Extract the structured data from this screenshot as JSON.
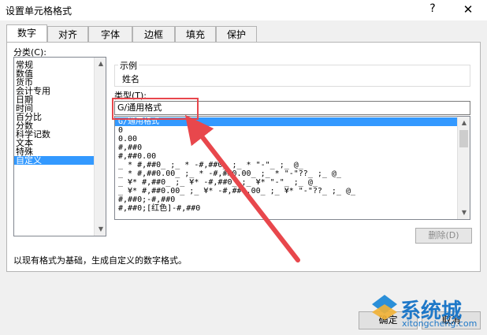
{
  "window": {
    "title": "设置单元格格式",
    "help": "?",
    "close": "✕"
  },
  "tabs": [
    {
      "label": "数字",
      "active": true
    },
    {
      "label": "对齐"
    },
    {
      "label": "字体"
    },
    {
      "label": "边框"
    },
    {
      "label": "填充"
    },
    {
      "label": "保护"
    }
  ],
  "category": {
    "label": "分类(C):",
    "items": [
      "常规",
      "数值",
      "货币",
      "会计专用",
      "日期",
      "时间",
      "百分比",
      "分数",
      "科学记数",
      "文本",
      "特殊",
      "自定义"
    ],
    "selected_index": 11
  },
  "sample": {
    "label": "示例",
    "value": "姓名"
  },
  "type": {
    "label": "类型(T):",
    "value": "G/通用格式",
    "formats": [
      "G/通用格式",
      "0",
      "0.00",
      "#,##0",
      "#,##0.00",
      "_ * #,##0_ ;_ * -#,##0_ ;_ * \"-\"_ ;_ @_",
      "_ * #,##0.00_ ;_ * -#,##0.00_ ;_ * \"-\"??_ ;_ @_",
      "_ ¥* #,##0_ ;_ ¥* -#,##0_ ;_ ¥* \"-\"_ ;_ @_",
      "_ ¥* #,##0.00_ ;_ ¥* -#,##0.00_ ;_ ¥* \"-\"??_ ;_ @_",
      "#,##0;-#,##0",
      "#,##0;[红色]-#,##0"
    ],
    "selected_index": 0
  },
  "delete_button": "删除(D)",
  "description": "以现有格式为基础，生成自定义的数字格式。",
  "buttons": {
    "ok": "确定",
    "cancel": "取消"
  },
  "watermark": {
    "brand": "系统城",
    "url": "xitongcheng.com"
  },
  "colors": {
    "selection": "#3399ff",
    "annotation": "#e8474c",
    "watermark": "#1e78c8"
  }
}
